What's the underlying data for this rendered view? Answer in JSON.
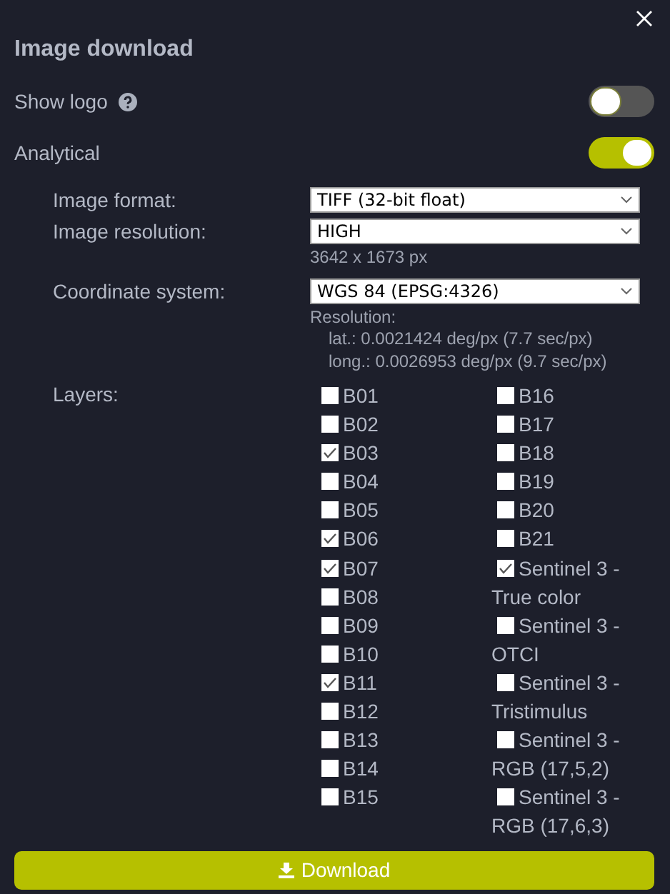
{
  "title": "Image download",
  "toggles": [
    {
      "label": "Show logo",
      "help": true,
      "on": false
    },
    {
      "label": "Analytical",
      "help": false,
      "on": true
    }
  ],
  "fields": [
    {
      "label": "Image format:",
      "value": "TIFF (32-bit float)"
    },
    {
      "label": "Image resolution:",
      "value": "HIGH",
      "notes": [
        "3642 x 1673 px"
      ]
    },
    {
      "label": "Coordinate system:",
      "value": "WGS 84 (EPSG:4326)",
      "notes": [
        "Resolution:",
        "lat.: 0.0021424 deg/px (7.7 sec/px)",
        "long.: 0.0026953 deg/px (9.7 sec/px)"
      ]
    }
  ],
  "layers": {
    "label": "Layers:",
    "columns": [
      [
        {
          "label": "B01",
          "checked": false
        },
        {
          "label": "B02",
          "checked": false
        },
        {
          "label": "B03",
          "checked": true
        },
        {
          "label": "B04",
          "checked": false
        },
        {
          "label": "B05",
          "checked": false
        },
        {
          "label": "B06",
          "checked": true
        },
        {
          "label": "B07",
          "checked": true
        },
        {
          "label": "B08",
          "checked": false
        },
        {
          "label": "B09",
          "checked": false
        },
        {
          "label": "B10",
          "checked": false
        },
        {
          "label": "B11",
          "checked": true
        },
        {
          "label": "B12",
          "checked": false
        },
        {
          "label": "B13",
          "checked": false
        },
        {
          "label": "B14",
          "checked": false
        },
        {
          "label": "B15",
          "checked": false
        }
      ],
      [
        {
          "label": "B16",
          "checked": false
        },
        {
          "label": "B17",
          "checked": false
        },
        {
          "label": "B18",
          "checked": false
        },
        {
          "label": "B19",
          "checked": false
        },
        {
          "label": "B20",
          "checked": false
        },
        {
          "label": "B21",
          "checked": false
        },
        {
          "label": "Sentinel 3 - True color",
          "checked": true
        },
        {
          "label": "Sentinel 3 - OTCI",
          "checked": false
        },
        {
          "label": "Sentinel 3 - Tristimulus",
          "checked": false
        },
        {
          "label": "Sentinel 3 - RGB (17,5,2)",
          "checked": false
        },
        {
          "label": "Sentinel 3 - RGB (17,6,3)",
          "checked": false
        }
      ]
    ]
  },
  "button": "Download"
}
